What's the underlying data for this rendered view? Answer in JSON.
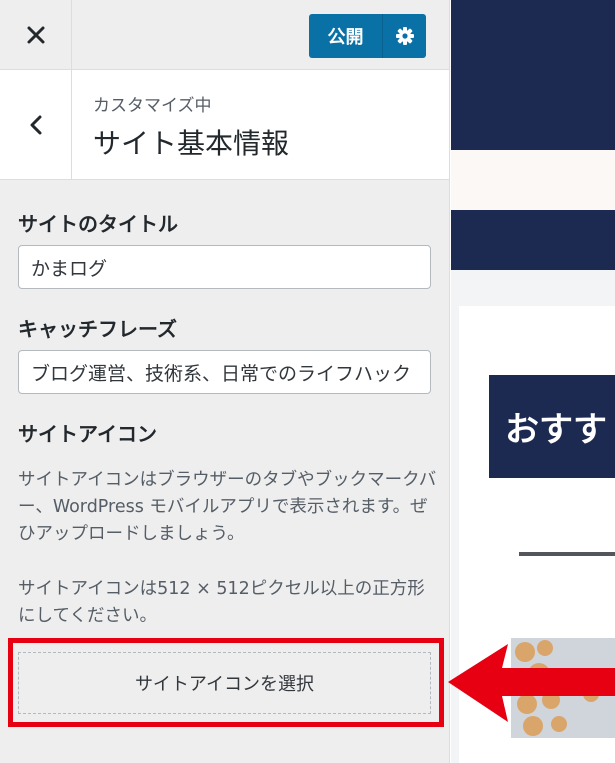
{
  "topbar": {
    "close_icon": "close-icon",
    "publish_label": "公開",
    "settings_icon": "gear-icon"
  },
  "section": {
    "back_icon": "chevron-left-icon",
    "customizing_label": "カスタマイズ中",
    "title": "サイト基本情報"
  },
  "fields": {
    "site_title_label": "サイトのタイトル",
    "site_title_value": "かまログ",
    "tagline_label": "キャッチフレーズ",
    "tagline_value": "ブログ運営、技術系、日常でのライフハック"
  },
  "site_icon": {
    "label": "サイトアイコン",
    "description_1": "サイトアイコンはブラウザーのタブやブックマークバー、WordPress モバイルアプリで表示されます。ぜひアップロードしましょう。",
    "description_2": "サイトアイコンは512 × 512ピクセル以上の正方形にしてください。",
    "select_button_label": "サイトアイコンを選択"
  },
  "preview": {
    "heading_text": "おすす"
  },
  "annotation": {
    "highlight_color": "#e60012",
    "arrow_color": "#e60012"
  },
  "colors": {
    "accent": "#0a71a7",
    "preview_navy": "#1c2a52"
  }
}
